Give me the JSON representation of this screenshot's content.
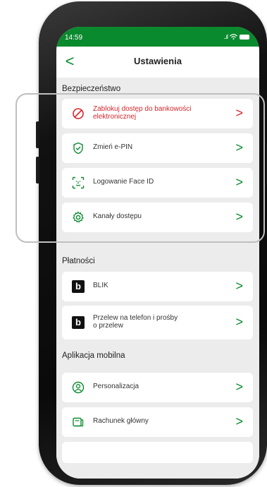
{
  "status_bar": {
    "time": "14:59",
    "signal": "..ıl"
  },
  "header": {
    "back_label": "<",
    "title": "Ustawienia"
  },
  "sections": [
    {
      "title": "Bezpieczeństwo",
      "items": [
        {
          "label_line1": "Zablokuj dostęp do bankowości",
          "label_line2": "elektronicznej",
          "icon": "block-icon",
          "variant": "danger"
        },
        {
          "label_line1": "Zmień e-PIN",
          "icon": "shield-check-icon"
        },
        {
          "label_line1": "Logowanie Face ID",
          "icon": "face-id-icon"
        },
        {
          "label_line1": "Kanały dostępu",
          "icon": "gear-icon"
        }
      ]
    },
    {
      "title": "Płatności",
      "items": [
        {
          "label_line1": "BLIK",
          "icon": "blik-icon"
        },
        {
          "label_line1": "Przelew na telefon i prośby",
          "label_line2": "o przelew",
          "icon": "blik-icon"
        }
      ]
    },
    {
      "title": "Aplikacja mobilna",
      "items": [
        {
          "label_line1": "Personalizacja",
          "icon": "person-icon"
        },
        {
          "label_line1": "Rachunek główny",
          "icon": "card-icon"
        }
      ]
    }
  ],
  "blik_glyph": "b",
  "chevron": ">",
  "colors": {
    "brand_green": "#0a8a2e",
    "danger_red": "#d7262b"
  }
}
